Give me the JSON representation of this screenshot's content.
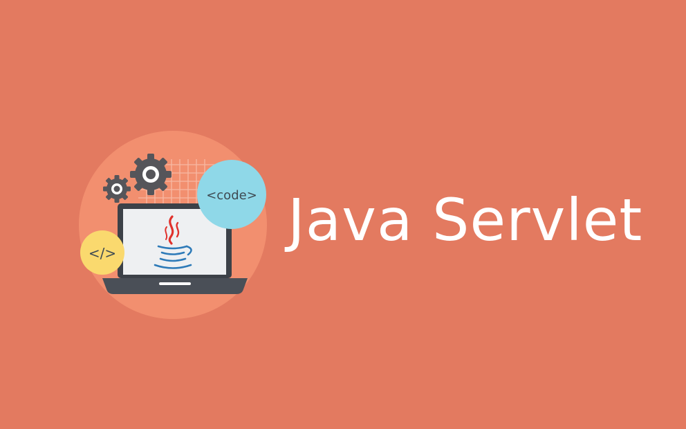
{
  "banner": {
    "title": "Java Servlet"
  },
  "badges": {
    "code_label": "<code>",
    "html_label": "</>"
  },
  "icons": [
    "gear-icon",
    "grid-icon",
    "laptop-icon",
    "java-logo-icon"
  ],
  "colors": {
    "background": "#e37a60",
    "circle": "#f28f6f",
    "code_badge": "#8fd8e8",
    "html_badge": "#fad96e",
    "gear": "#55555a",
    "laptop": "#3c4148",
    "java_red": "#e0312c",
    "java_blue": "#2d7ab8",
    "title_text": "#ffffff"
  }
}
